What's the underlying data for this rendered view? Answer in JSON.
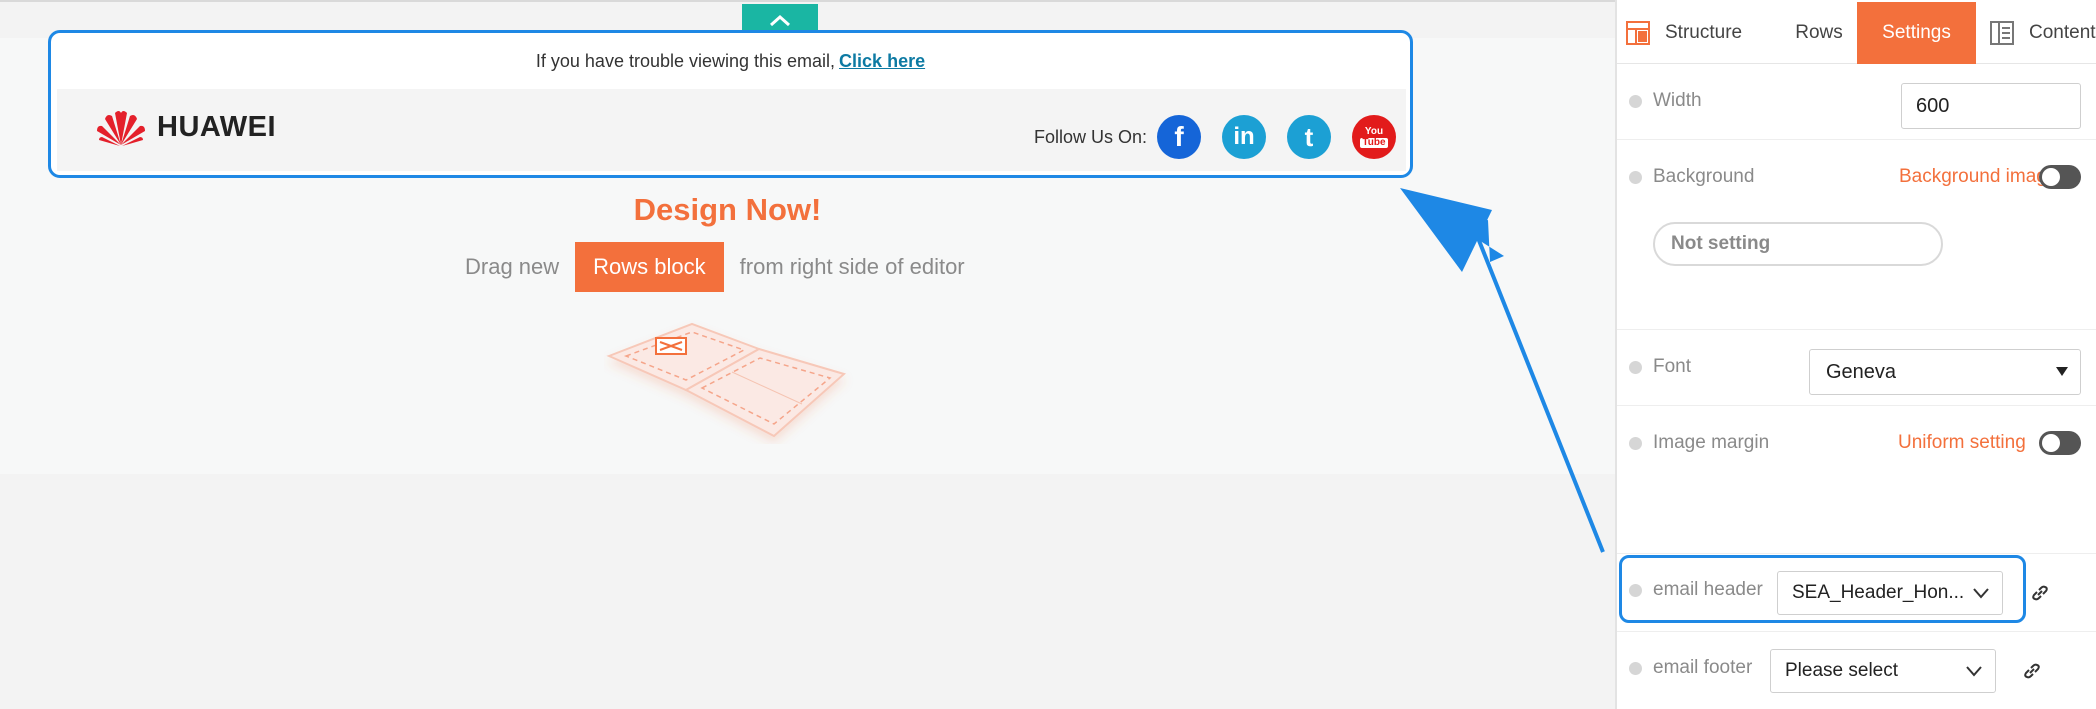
{
  "email_header_preview": {
    "trouble_text": "If you have trouble viewing this email,",
    "click_here": "Click here",
    "brand": "HUAWEI",
    "follow_label": "Follow Us On:",
    "social": [
      {
        "icon": "facebook-icon",
        "glyph": "f"
      },
      {
        "icon": "linkedin-icon",
        "glyph": "in"
      },
      {
        "icon": "twitter-icon",
        "glyph": "t"
      },
      {
        "icon": "youtube-icon",
        "glyph_top": "You",
        "glyph_bottom": "Tube"
      }
    ]
  },
  "canvas": {
    "heading": "Design Now!",
    "drag_prefix": "Drag new",
    "rows_block": "Rows block",
    "drag_suffix": "from right side of editor"
  },
  "panel": {
    "tabs": [
      "Structure",
      "Rows",
      "Settings",
      "Content"
    ],
    "active_tab": "Settings",
    "width_label": "Width",
    "width_value": "600",
    "background_label": "Background",
    "background_image_label": "Background image",
    "background_value": "Not setting",
    "font_label": "Font",
    "font_value": "Geneva",
    "image_margin_label": "Image margin",
    "uniform_setting_label": "Uniform setting",
    "email_header_label": "email header",
    "email_header_value": "SEA_Header_Hon...",
    "email_footer_label": "email footer",
    "email_footer_value": "Please select"
  },
  "colors": {
    "accent": "#f3703c",
    "highlight": "#1e88e5",
    "tab_toggle": "#1ab6a3"
  }
}
